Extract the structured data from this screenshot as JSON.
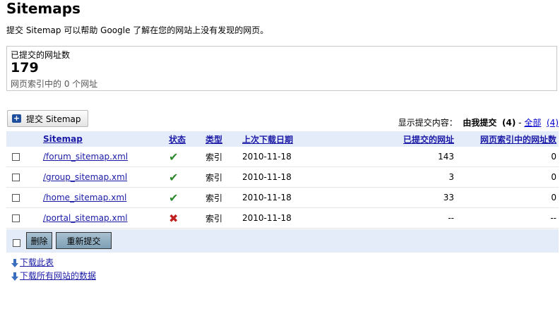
{
  "page": {
    "title": "Sitemaps",
    "subtitle": "提交  Sitemap 可以帮助  Google 了解在您的网站上没有发现的网页。"
  },
  "stats": {
    "submitted_label": "已提交的网址数",
    "submitted_count": "179",
    "indexed_text": "网页索引中的  0 个网址"
  },
  "toolbar": {
    "submit_label": "提交  Sitemap",
    "filter_prefix": "显示提交内容：",
    "filter_mine": "由我提交",
    "filter_mine_count": "(4)",
    "filter_sep": "-",
    "filter_all": "全部",
    "filter_all_count": "(4)"
  },
  "table": {
    "headers": {
      "sitemap": "Sitemap",
      "status": "状态",
      "type": "类型",
      "last_download": "上次下载日期",
      "submitted_urls": "已提交的网址",
      "indexed_urls": "网页索引中的网址数"
    },
    "rows": [
      {
        "name": "/forum_sitemap.xml",
        "status": "ok",
        "type": "索引",
        "date": "2010-11-18",
        "submitted": "143",
        "indexed": "0"
      },
      {
        "name": "/group_sitemap.xml",
        "status": "ok",
        "type": "索引",
        "date": "2010-11-18",
        "submitted": "3",
        "indexed": "0"
      },
      {
        "name": "/home_sitemap.xml",
        "status": "ok",
        "type": "索引",
        "date": "2010-11-18",
        "submitted": "33",
        "indexed": "0"
      },
      {
        "name": "/portal_sitemap.xml",
        "status": "error",
        "type": "索引",
        "date": "2010-11-18",
        "submitted": "--",
        "indexed": "--"
      }
    ]
  },
  "actions": {
    "delete_label": "删除",
    "resubmit_label": "重新提交"
  },
  "links": {
    "download_table": "下载此表",
    "download_all": "下载所有网站的数据"
  },
  "colors": {
    "header_bg": "#e5ecf9",
    "link": "#1a1aa6",
    "ok": "#2f8a2f",
    "error": "#c02020"
  },
  "icons": {
    "ok": "check-icon",
    "error": "cross-icon",
    "submit": "plus-icon",
    "download": "download-arrow-icon"
  }
}
